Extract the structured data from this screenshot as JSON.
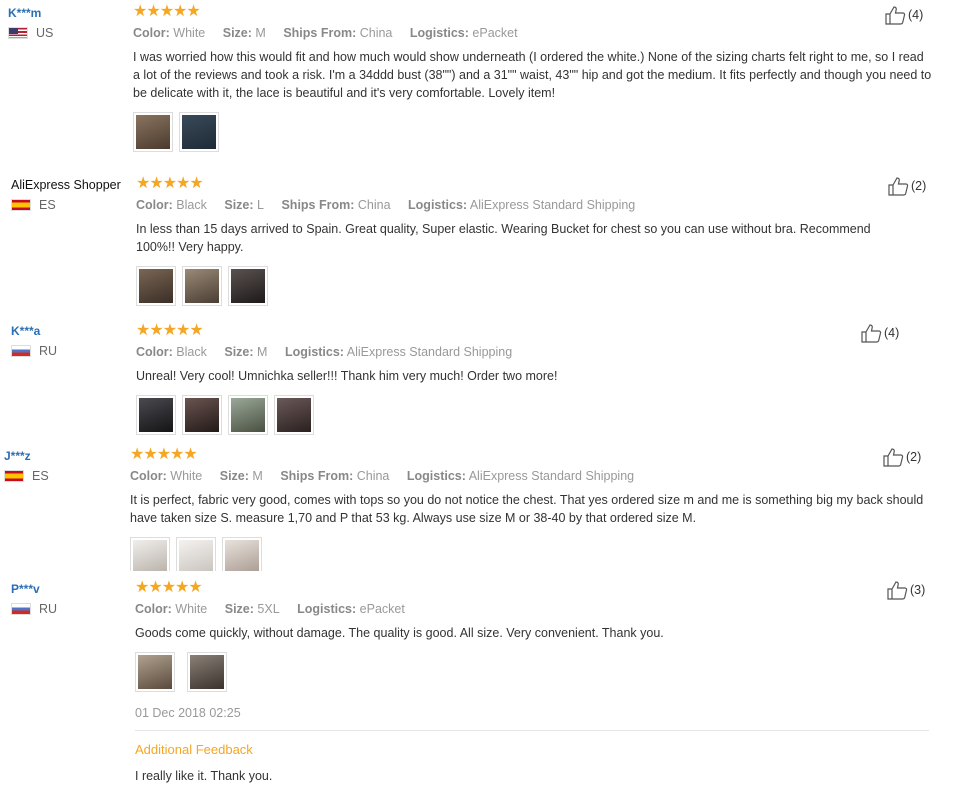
{
  "reviews": [
    {
      "user": "K***m",
      "country": "US",
      "flag": "us",
      "stars": "★★★★★",
      "meta": [
        {
          "key": "Color:",
          "val": "White"
        },
        {
          "key": "Size:",
          "val": "M"
        },
        {
          "key": "Ships From:",
          "val": "China"
        },
        {
          "key": "Logistics:",
          "val": "ePacket"
        }
      ],
      "text": "I was worried how this would fit and how much would show underneath (I ordered the white.) None of the sizing charts felt right to me, so I read a lot of the reviews and took a risk. I'm a 34ddd bust (38\"\") and a 31\"\" waist, 43\"\" hip and got the medium. It fits perfectly and though you need to be delicate with it, the lace is beautiful and it's very comfortable. Lovely item!",
      "photos": [
        "#6b5a4a",
        "#2d3a4a"
      ],
      "likes": "(4)"
    },
    {
      "user": "AliExpress Shopper",
      "country": "ES",
      "flag": "es",
      "stars": "★★★★★",
      "meta": [
        {
          "key": "Color:",
          "val": "Black"
        },
        {
          "key": "Size:",
          "val": "L"
        },
        {
          "key": "Ships From:",
          "val": "China"
        },
        {
          "key": "Logistics:",
          "val": "AliExpress Standard Shipping"
        }
      ],
      "text": "In less than 15 days arrived to Spain. Great quality, Super elastic. Wearing Bucket for chest so you can use without bra. Recommend 100%!! Very happy.",
      "photos": [
        "#5a4a3e",
        "#7a6a5a",
        "#3a3535"
      ],
      "likes": "(2)"
    },
    {
      "user": "K***a",
      "country": "RU",
      "flag": "ru",
      "stars": "★★★★★",
      "meta": [
        {
          "key": "Color:",
          "val": "Black"
        },
        {
          "key": "Size:",
          "val": "M"
        },
        {
          "key": "Logistics:",
          "val": "AliExpress Standard Shipping"
        }
      ],
      "text": "Unreal! Very cool! Umnichka seller!!! Thank him very much! Order two more!",
      "photos": [
        "#2a2a2e",
        "#4a3a38",
        "#6e7a6a",
        "#4a3a3a"
      ],
      "likes": "(4)"
    },
    {
      "user": "J***z",
      "country": "ES",
      "flag": "es",
      "stars": "★★★★★",
      "meta": [
        {
          "key": "Color:",
          "val": "White"
        },
        {
          "key": "Size:",
          "val": "M"
        },
        {
          "key": "Ships From:",
          "val": "China"
        },
        {
          "key": "Logistics:",
          "val": "AliExpress Standard Shipping"
        }
      ],
      "text": "It is perfect, fabric very good, comes with tops so you do not notice the chest. That yes ordered size m and me is something big my back should have taken size S. measure 1,70 and P that 53 kg. Always use size M or 38-40 by that ordered size M.",
      "photos": [
        "#d8d4d0",
        "#e2dfdc",
        "#c8c0ba"
      ],
      "likes": "(2)"
    },
    {
      "user": "P***v",
      "country": "RU",
      "flag": "ru",
      "stars": "★★★★★",
      "meta": [
        {
          "key": "Color:",
          "val": "White"
        },
        {
          "key": "Size:",
          "val": "5XL"
        },
        {
          "key": "Logistics:",
          "val": "ePacket"
        }
      ],
      "text": "Goods come quickly, without damage. The quality is good. All size. Very convenient. Thank you.",
      "photos": [
        "#8a7a6a",
        "#5a5048"
      ],
      "likes": "(3)",
      "date": "01 Dec 2018 02:25",
      "additional_title": "Additional Feedback",
      "additional_text": "I really like it. Thank you."
    }
  ],
  "icons": {
    "like": "thumbs-up-icon",
    "star": "star-icon"
  }
}
